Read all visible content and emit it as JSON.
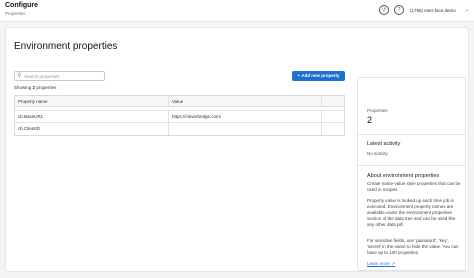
{
  "header": {
    "title": "Configure",
    "subtitle": "Properties",
    "workspace": "(1796) Inter-face demo",
    "icons": [
      "history-icon",
      "help-icon",
      "chevron-down-icon"
    ]
  },
  "main": {
    "page_title": "Environment properties",
    "search_placeholder": "Search properties",
    "add_button": "+ Add new property",
    "showing_prefix": "Showing",
    "showing_count": "2",
    "showing_suffix": "properties",
    "table": {
      "columns": [
        "Property name",
        "Value"
      ],
      "rows": [
        {
          "name": "cb.BaseURL",
          "value": "https://cleverbridge.com/"
        },
        {
          "name": "cb.ClientID",
          "value": ""
        }
      ]
    }
  },
  "side": {
    "properties_label": "Properties",
    "properties_count": "2",
    "latest_activity_heading": "Latest activity",
    "latest_activity_text": "No activity",
    "about_heading": "About environment properties",
    "about_p1": "Create name-value style properties that can be used in recipes.",
    "about_p2": "Property value is looked up each time job is executed. Environment property names are available under the environment properties section of the data tree and can be used like any other data pill.",
    "about_p3": "For sensitive fields, use 'password', 'key', 'secret' in the name to hide the value. You can have up to 100 properties.",
    "learn_more": "Learn more"
  },
  "colors": {
    "accent": "#1f6fd1",
    "background": "#f4f4f4",
    "card": "#ffffff"
  }
}
